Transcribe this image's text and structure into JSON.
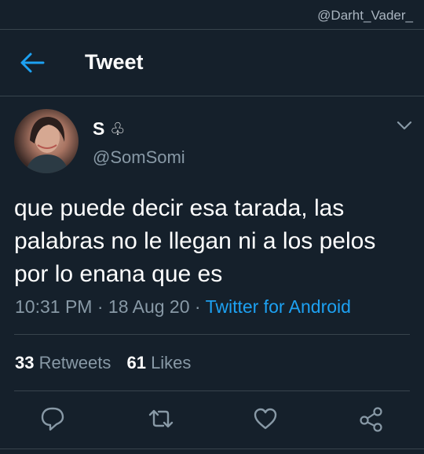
{
  "watermark": "@Darht_Vader_",
  "header": {
    "title": "Tweet"
  },
  "tweet": {
    "display_name": "S",
    "name_badge": "♧",
    "handle": "@SomSomi",
    "text": "que puede decir esa tarada, las palabras no le llegan ni a los pelos por lo enana que es",
    "time": "10:31 PM",
    "date": "18 Aug 20",
    "separator": "·",
    "source": "Twitter for Android"
  },
  "stats": {
    "retweets_count": "33",
    "retweets_label": "Retweets",
    "likes_count": "61",
    "likes_label": "Likes"
  },
  "icons": {
    "back": "arrow-left-icon",
    "menu": "chevron-down-icon",
    "reply": "reply-icon",
    "retweet": "retweet-icon",
    "like": "heart-icon",
    "share": "share-icon"
  },
  "colors": {
    "background": "#15202b",
    "accent": "#1da1f2",
    "secondary_text": "#8899a6",
    "divider": "#38444d"
  }
}
